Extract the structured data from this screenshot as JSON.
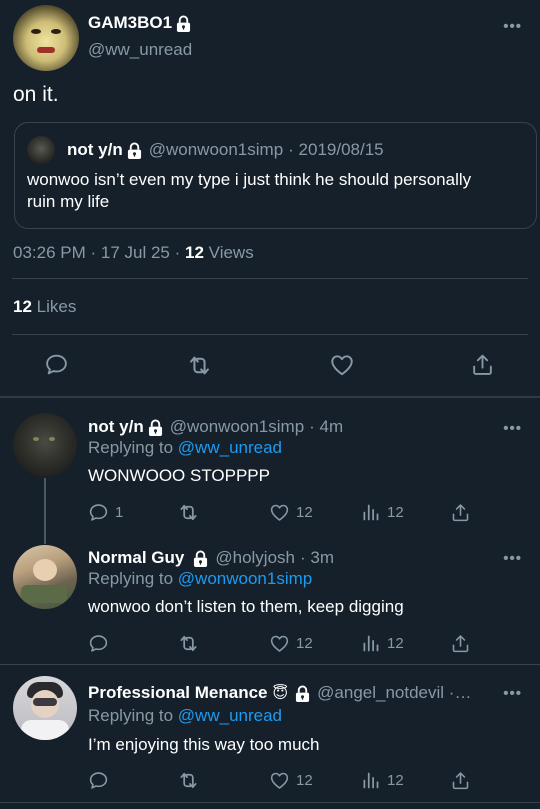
{
  "main_tweet": {
    "display_name": "GAM3BO1",
    "handle": "@ww_unread",
    "more": "•••",
    "text": "on it.",
    "quoted": {
      "display_name": "not y/n",
      "handle": "@wonwoon1simp",
      "date": "· 2019/08/15",
      "text": "wonwoo isn’t even my type i just think he should personally ruin my life"
    },
    "meta": {
      "time": "03:26 PM · 17 Jul 25 ·",
      "views_count": "12",
      "views_label": "Views"
    },
    "likes": {
      "count": "12",
      "label": "Likes"
    }
  },
  "replies": [
    {
      "display_name": "not y/n",
      "handle": "@wonwoon1simp",
      "time": "· 4m",
      "replying_prefix": "Replying to",
      "replying_to": "@ww_unread",
      "text": "WONWOOO STOPPPP",
      "reply_count": "1",
      "like_count": "12",
      "view_count": "12"
    },
    {
      "display_name": "Normal Guy",
      "handle": "@holyjosh",
      "time": "· 3m",
      "replying_prefix": "Replying to",
      "replying_to": "@wonwoon1simp",
      "text": "wonwoo don’t listen to them, keep digging",
      "reply_count": "",
      "like_count": "12",
      "view_count": "12"
    },
    {
      "display_name": "Professional Menance",
      "emoji": "😇",
      "handle": "@angel_notdevil ·…",
      "time": "",
      "replying_prefix": "Replying to",
      "replying_to": "@ww_unread",
      "text": "I’m enjoying this way too much",
      "reply_count": "",
      "like_count": "12",
      "view_count": "12"
    }
  ],
  "colors": {
    "background": "#15202b",
    "muted": "#8899a6",
    "link": "#1d9bf0",
    "divider": "#38444d"
  }
}
